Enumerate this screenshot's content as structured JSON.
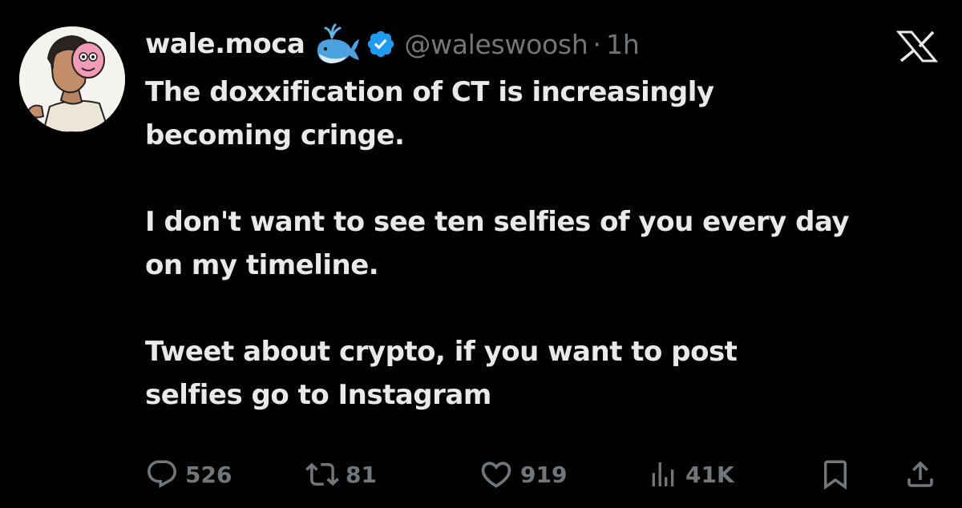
{
  "tweet": {
    "author": {
      "display_name": "wale.moca",
      "handle": "@waleswoosh",
      "separator": "·",
      "time": "1h",
      "name_emoji": "whale-icon",
      "badge": "verified-icon"
    },
    "text": [
      "The doxxification of CT is increasingly",
      "becoming cringe.",
      "",
      "I don't want to see ten selfies of you every day",
      "on my timeline.",
      "",
      "Tweet about crypto, if you want to post",
      "selfies go to Instagram"
    ],
    "actions": {
      "replies": "526",
      "reposts": "81",
      "likes": "919",
      "views": "41K"
    }
  },
  "colors": {
    "background": "#000000",
    "text_primary": "#e7e9ea",
    "text_secondary": "#71767b",
    "verified_blue": "#1d9bf0",
    "whale": "#4aa3df"
  }
}
